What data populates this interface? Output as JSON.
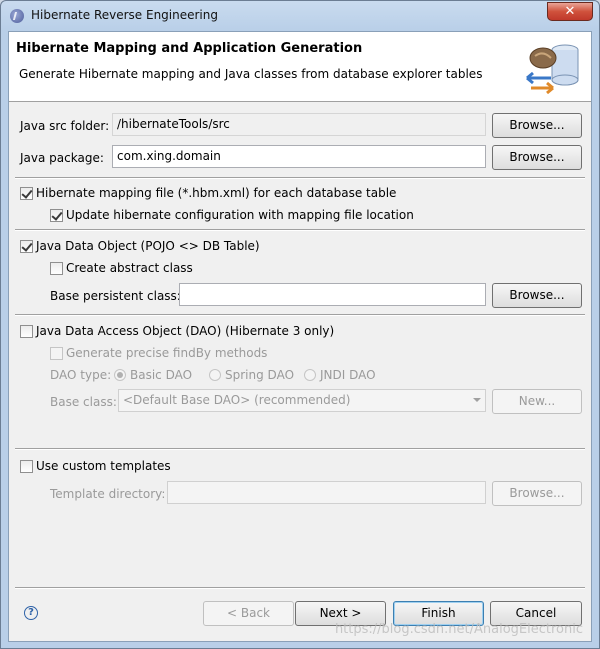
{
  "window": {
    "title": "Hibernate Reverse Engineering",
    "close_glyph": "✕"
  },
  "banner": {
    "title": "Hibernate Mapping and Application Generation",
    "description": "Generate Hibernate mapping and Java classes from database explorer tables",
    "icon": "database-wizard-icon"
  },
  "src_folder": {
    "label": "Java src folder:",
    "value": "/hibernateTools/src",
    "browse": "Browse..."
  },
  "package": {
    "label": "Java package:",
    "value": "com.xing.domain",
    "browse": "Browse..."
  },
  "mapping": {
    "label": "Hibernate mapping file (*.hbm.xml) for each database table",
    "checked": true,
    "update_label": "Update hibernate configuration with mapping file location",
    "update_checked": true
  },
  "pojo": {
    "label": "Java Data Object (POJO <> DB Table)",
    "checked": true,
    "abstract_label": "Create abstract class",
    "abstract_checked": false,
    "base_label": "Base persistent class:",
    "base_value": "",
    "browse": "Browse..."
  },
  "dao": {
    "label": "Java Data Access Object (DAO) (Hibernate 3 only)",
    "checked": false,
    "findby_label": "Generate precise findBy methods",
    "type_label": "DAO type:",
    "types": [
      "Basic DAO",
      "Spring DAO",
      "JNDI DAO"
    ],
    "selected_type": "Basic DAO",
    "base_class_label": "Base class:",
    "base_class_value": "<Default Base DAO> (recommended)",
    "new_button": "New..."
  },
  "templates": {
    "label": "Use custom templates",
    "checked": false,
    "dir_label": "Template directory:",
    "dir_value": "",
    "browse": "Browse..."
  },
  "footer": {
    "help_glyph": "?",
    "back": "< Back",
    "next": "Next >",
    "finish": "Finish",
    "cancel": "Cancel"
  },
  "watermark": "https://blog.csdn.net/AnalogElectronic"
}
